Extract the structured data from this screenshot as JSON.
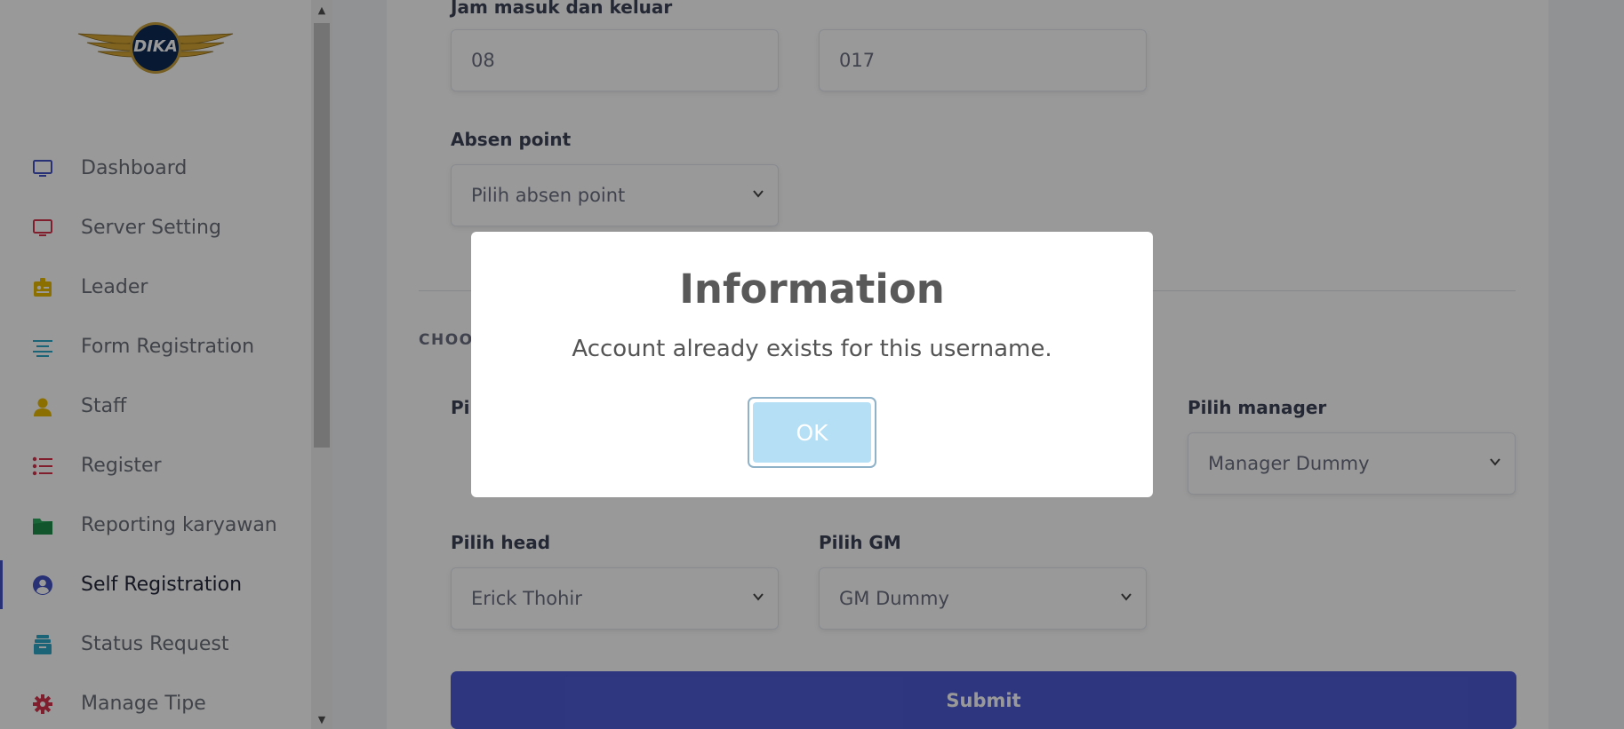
{
  "sidebar": {
    "logo_text": "DIKA",
    "items": [
      {
        "label": "Dashboard",
        "icon": "monitor-icon",
        "color": "#4452c4"
      },
      {
        "label": "Server Setting",
        "icon": "monitor-icon",
        "color": "#d6334d"
      },
      {
        "label": "Leader",
        "icon": "id-badge-icon",
        "color": "#e8b900"
      },
      {
        "label": "Form Registration",
        "icon": "align-left-icon",
        "color": "#2ea7c9"
      },
      {
        "label": "Staff",
        "icon": "user-icon",
        "color": "#e8b900"
      },
      {
        "label": "Register",
        "icon": "list-icon",
        "color": "#d6334d"
      },
      {
        "label": "Reporting karyawan",
        "icon": "folder-icon",
        "color": "#2dab5f"
      },
      {
        "label": "Self Registration",
        "icon": "user-circle-icon",
        "color": "#4452c4"
      },
      {
        "label": "Status Request",
        "icon": "archive-icon",
        "color": "#2ea7c9"
      },
      {
        "label": "Manage Tipe",
        "icon": "gear-icon",
        "color": "#d6334d"
      }
    ],
    "active_index": 7
  },
  "form": {
    "jam_label": "Jam masuk dan keluar",
    "jam_masuk": "08",
    "jam_keluar": "017",
    "absen_label": "Absen point",
    "absen_placeholder": "Pilih absen point",
    "section_heading": "CHOOS",
    "pilih_partial_label": "Pil",
    "manager_label": "Pilih manager",
    "manager_value": "Manager Dummy",
    "head_label": "Pilih head",
    "head_value": "Erick Thohir",
    "gm_label": "Pilih GM",
    "gm_value": "GM Dummy",
    "submit_label": "Submit"
  },
  "modal": {
    "title": "Information",
    "message": "Account already exists for this username.",
    "ok_label": "OK"
  },
  "colors": {
    "primary": "#4c5bd4",
    "ok_button": "#b4dff5"
  }
}
